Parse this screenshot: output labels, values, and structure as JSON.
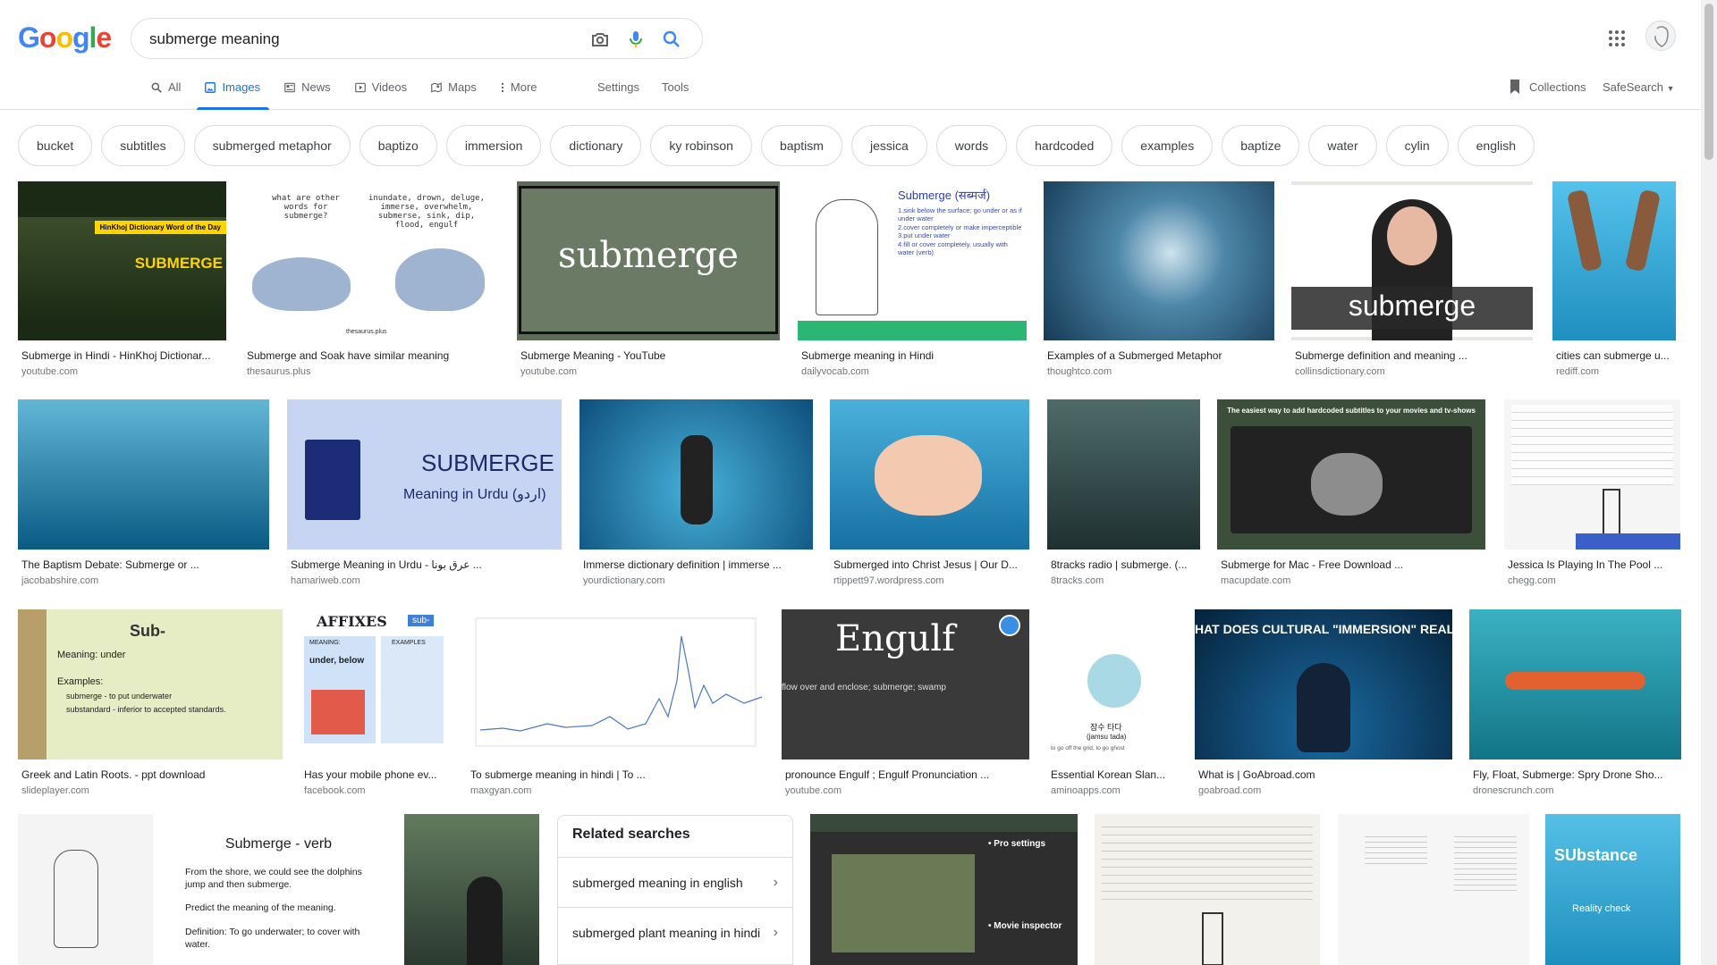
{
  "logo": {
    "letters": [
      "G",
      "o",
      "o",
      "g",
      "l",
      "e"
    ],
    "colors": [
      "#4285F4",
      "#EA4335",
      "#FBBC05",
      "#4285F4",
      "#34A853",
      "#EA4335"
    ]
  },
  "search": {
    "query": "submerge meaning"
  },
  "tabs": [
    {
      "label": "All",
      "icon": "search-icon"
    },
    {
      "label": "Images",
      "icon": "image-icon",
      "active": true
    },
    {
      "label": "News",
      "icon": "news-icon"
    },
    {
      "label": "Videos",
      "icon": "video-icon"
    },
    {
      "label": "Maps",
      "icon": "map-icon"
    },
    {
      "label": "More",
      "icon": "more-vert-icon"
    }
  ],
  "tools": {
    "settings": "Settings",
    "tools": "Tools"
  },
  "collections": "Collections",
  "safesearch": "SafeSearch",
  "chips": [
    "bucket",
    "subtitles",
    "submerged metaphor",
    "baptizo",
    "immersion",
    "dictionary",
    "ky robinson",
    "baptism",
    "jessica",
    "words",
    "hardcoded",
    "examples",
    "baptize",
    "water",
    "cylin",
    "english"
  ],
  "results": [
    {
      "caption": "Submerge in Hindi - HinKhoj Dictionar...",
      "source": "youtube.com",
      "thumb_text": "SUBMERGE",
      "bg": "#1b2a14"
    },
    {
      "caption": "Submerge and Soak have similar meaning",
      "source": "thesaurus.plus",
      "thumb_text": "",
      "bg": "#ffffff"
    },
    {
      "caption": "Submerge Meaning - YouTube",
      "source": "youtube.com",
      "thumb_text": "submerge",
      "bg": "#5d6b58"
    },
    {
      "caption": "Submerge meaning in Hindi",
      "source": "dailyvocab.com",
      "thumb_text": "Submerge (सब्मर्ज)",
      "bg": "#ffffff"
    },
    {
      "caption": "Examples of a Submerged Metaphor",
      "source": "thoughtco.com",
      "thumb_text": "",
      "bg": "#2e5f80"
    },
    {
      "caption": "Submerge definition and meaning ...",
      "source": "collinsdictionary.com",
      "thumb_text": "submerge",
      "bg": "#e8e6e3"
    },
    {
      "caption": "cities can submerge u...",
      "source": "rediff.com",
      "thumb_text": "",
      "bg": "#2ea7d8"
    },
    {
      "caption": "The Baptism Debate: Submerge or ...",
      "source": "jacobabshire.com",
      "thumb_text": "",
      "bg": "#1a7ea8"
    },
    {
      "caption": "Submerge Meaning in Urdu - عرق بونا ...",
      "source": "hamariweb.com",
      "thumb_text": "SUBMERGE",
      "bg": "#c7d4f2"
    },
    {
      "caption": "Immerse dictionary definition | immerse ...",
      "source": "yourdictionary.com",
      "thumb_text": "",
      "bg": "#1d6b9c"
    },
    {
      "caption": "Submerged into Christ Jesus | Our D...",
      "source": "rtippett97.wordpress.com",
      "thumb_text": "",
      "bg": "#2b8fc0"
    },
    {
      "caption": "8tracks radio | submerge. (...",
      "source": "8tracks.com",
      "thumb_text": "",
      "bg": "#2f4a4a"
    },
    {
      "caption": "Submerge for Mac - Free Download ...",
      "source": "macupdate.com",
      "thumb_text": "",
      "bg": "#3b4f3a"
    },
    {
      "caption": "Jessica Is Playing In The Pool ...",
      "source": "chegg.com",
      "thumb_text": "",
      "bg": "#f5f5f5"
    },
    {
      "caption": "Greek and Latin Roots. - ppt download",
      "source": "slideplayer.com",
      "thumb_text": "Sub-",
      "bg": "#e6ecc4"
    },
    {
      "caption": "Has your mobile phone ev...",
      "source": "facebook.com",
      "thumb_text": "AFFIXES",
      "bg": "#ffffff"
    },
    {
      "caption": "To submerge meaning in hindi | To ...",
      "source": "maxgyan.com",
      "thumb_text": "",
      "bg": "#ffffff"
    },
    {
      "caption": "pronounce Engulf ; Engulf Pronunciation ...",
      "source": "youtube.com",
      "thumb_text": "Engulf",
      "bg": "#3a3a3a"
    },
    {
      "caption": "Essential Korean Slan...",
      "source": "aminoapps.com",
      "thumb_text": "",
      "bg": "#ffffff"
    },
    {
      "caption": "What is | GoAbroad.com",
      "source": "goabroad.com",
      "thumb_text": "HAT DOES CULTURAL \"IMMERSION\" REALLY MEAN?",
      "bg": "#0b2a47"
    },
    {
      "caption": "Fly, Float, Submerge: Spry Drone Sho...",
      "source": "dronescrunch.com",
      "thumb_text": "",
      "bg": "#1e8a9a"
    },
    {
      "caption": "",
      "source": "",
      "thumb_text": "",
      "bg": "#f4f4f4"
    },
    {
      "caption": "",
      "source": "",
      "thumb_text": "Submerge - verb",
      "bg": "#ffffff"
    },
    {
      "caption": "",
      "source": "",
      "thumb_text": "",
      "bg": "#3f5a4a"
    },
    {
      "caption": "",
      "source": "",
      "thumb_text": "",
      "bg": "#3a4a3a"
    },
    {
      "caption": "",
      "source": "",
      "thumb_text": "",
      "bg": "#f3f1ec"
    },
    {
      "caption": "",
      "source": "",
      "thumb_text": "",
      "bg": "#f6f6f6"
    },
    {
      "caption": "",
      "source": "",
      "thumb_text": "SUbstance",
      "bg": "#2aa7d1"
    }
  ],
  "thumb_extras": {
    "hinkhoj_banner": "HinKhoj Dictionary Word of the Day",
    "thesaurus_q": "what are other words for submerge?",
    "thesaurus_a": "inundate, drown, deluge, immerse, overwhelm, submerse, sink, dip, flood, engulf",
    "thesaurus_src": "thesaurus.plus",
    "urdu_sub": "Meaning in Urdu (اردو)",
    "dailyvocab_lines": [
      "1.sink below the surface; go under or as if under water",
      "2.cover completely or make imperceptible",
      "3.put under water",
      "4.fill or cover completely, usually with water (verb)"
    ],
    "sub_meaning": "Meaning: under",
    "sub_examples": "Examples:",
    "sub_ex1": "submerge - to put underwater",
    "sub_ex2": "substandard - inferior to accepted standards.",
    "affix_tag": "sub-",
    "affix_meaning": "MEANING:",
    "affix_under": "under, below",
    "affix_examples": "EXAMPLES",
    "engulf_sub": "flow over and enclose; submerge; swamp",
    "korean_text": "잠수 타다",
    "korean_roman": "(jamsu tada)",
    "korean_foot": "to go off the grid, to go ghost",
    "mac_title": "The easiest way to add hardcoded subtitles to your movies and tv-shows",
    "verb_bullets": [
      "From the shore, we could see the dolphins jump and then submerge.",
      "Predict the meaning of the meaning.",
      "Definition: To go underwater; to cover with water."
    ],
    "pro_settings": "• Pro settings",
    "movie_inspector": "• Movie inspector",
    "reality_check": "Reality check"
  },
  "related": {
    "title": "Related searches",
    "items": [
      "submerged meaning in english",
      "submerged plant meaning in hindi"
    ]
  }
}
